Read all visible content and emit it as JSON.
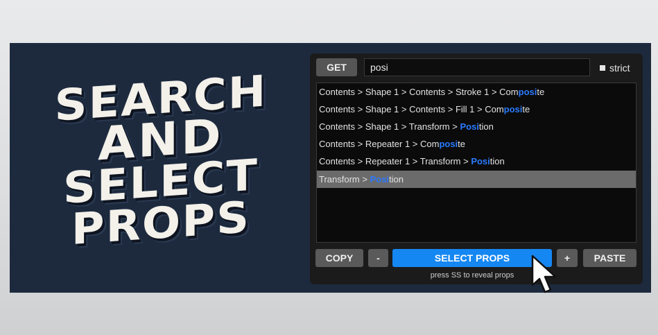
{
  "title": {
    "line1": "SEARCH",
    "line2": "AND",
    "line3": "SELECT",
    "line4": "PROPS"
  },
  "toolbar": {
    "get_label": "GET",
    "search_value": "posi",
    "strict_label": "strict"
  },
  "results": [
    {
      "prefix": "Contents > Shape 1 > Contents > Stroke 1 > Com",
      "match": "posi",
      "suffix": "te"
    },
    {
      "prefix": "Contents > Shape 1 > Contents > Fill 1 > Com",
      "match": "posi",
      "suffix": "te"
    },
    {
      "prefix": "Contents > Shape 1 > Transform > ",
      "match": "Posi",
      "suffix": "tion"
    },
    {
      "prefix": "Contents > Repeater 1 > Com",
      "match": "posi",
      "suffix": "te"
    },
    {
      "prefix": "Contents > Repeater 1 > Transform > ",
      "match": "Posi",
      "suffix": "tion"
    },
    {
      "prefix": "Transform > ",
      "match": "Posi",
      "suffix": "tion",
      "selected": true
    }
  ],
  "actions": {
    "copy_label": "COPY",
    "minus_label": "-",
    "select_label": "SELECT PROPS",
    "plus_label": "+",
    "paste_label": "PASTE",
    "hint": "press SS to reveal props"
  },
  "colors": {
    "banner": "#1d2a3e",
    "accent": "#1587f2",
    "highlight": "#2a7bff"
  },
  "icons": {
    "cursor": "mouse-pointer-icon",
    "strict_checkbox": "checkbox-icon"
  }
}
